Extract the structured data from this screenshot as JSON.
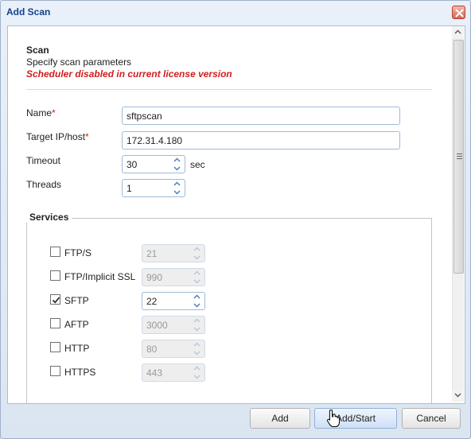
{
  "dialog": {
    "title": "Add Scan"
  },
  "section": {
    "title": "Scan",
    "subtitle": "Specify scan parameters",
    "warning": "Scheduler disabled in current license version"
  },
  "form": {
    "name_label": "Name",
    "name_value": "sftpscan",
    "target_label": "Target IP/host",
    "target_value": "172.31.4.180",
    "timeout_label": "Timeout",
    "timeout_value": "30",
    "timeout_unit": "sec",
    "threads_label": "Threads",
    "threads_value": "1",
    "required_mark": "*"
  },
  "services": {
    "legend": "Services",
    "items": [
      {
        "label": "FTP/S",
        "checked": false,
        "port": "21",
        "enabled": false
      },
      {
        "label": "FTP/Implicit SSL",
        "checked": false,
        "port": "990",
        "enabled": false
      },
      {
        "label": "SFTP",
        "checked": true,
        "port": "22",
        "enabled": true
      },
      {
        "label": "AFTP",
        "checked": false,
        "port": "3000",
        "enabled": false
      },
      {
        "label": "HTTP",
        "checked": false,
        "port": "80",
        "enabled": false
      },
      {
        "label": "HTTPS",
        "checked": false,
        "port": "443",
        "enabled": false
      }
    ]
  },
  "buttons": {
    "add": "Add",
    "add_start": "Add/Start",
    "cancel": "Cancel"
  },
  "icons": {
    "close": "close-icon",
    "scroll_up": "chevron-up-icon",
    "scroll_down": "chevron-down-icon",
    "cursor": "hand-pointer-icon"
  },
  "colors": {
    "title": "#15428b",
    "warning": "#d01f1f",
    "close_button": "#d9644f"
  }
}
